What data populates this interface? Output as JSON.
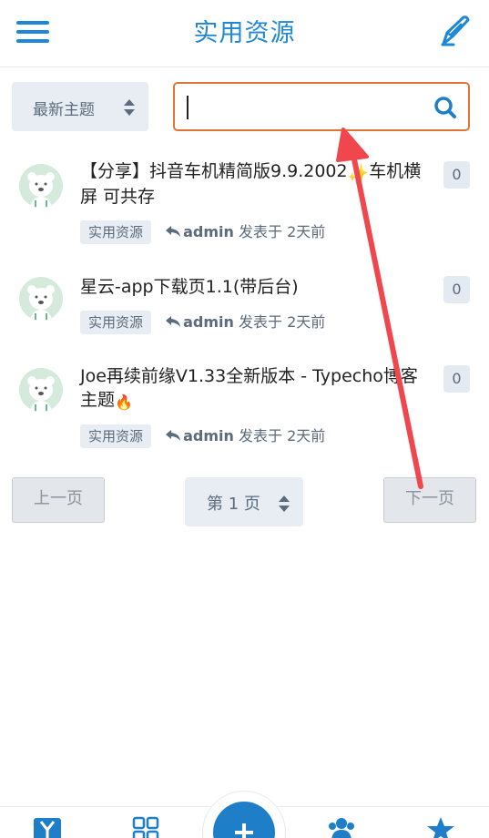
{
  "header": {
    "title": "实用资源",
    "menu_icon": "hamburger-menu-icon",
    "compose_icon": "pen-icon"
  },
  "filters": {
    "sort_label": "最新主题",
    "search_value": "",
    "search_icon": "search-icon"
  },
  "topics": [
    {
      "title": "【分享】抖音车机精简版9.9.2002",
      "title_suffix": "车机横屏 可共存",
      "emoji": "✨",
      "category": "实用资源",
      "author": "admin",
      "posted": "发表于 2天前",
      "replies": "0"
    },
    {
      "title": "星云-app下载页1.1(带后台)",
      "category": "实用资源",
      "author": "admin",
      "posted": "发表于 2天前",
      "replies": "0"
    },
    {
      "title": "Joe再续前缘V1.33全新版本 - Typecho博客主题",
      "emoji": "🔥",
      "category": "实用资源",
      "author": "admin",
      "posted": "发表于 2天前",
      "replies": "0"
    }
  ],
  "pagination": {
    "prev_label": "上一页",
    "page_label": "第 1 页",
    "next_label": "下一页"
  },
  "colors": {
    "accent": "#1e88d6",
    "search_border": "#e07438",
    "annotation_arrow": "#f0474f"
  },
  "bottom_nav": {
    "items": [
      "logo-icon",
      "grid-icon",
      "plus-icon",
      "users-icon",
      "star-icon"
    ]
  }
}
